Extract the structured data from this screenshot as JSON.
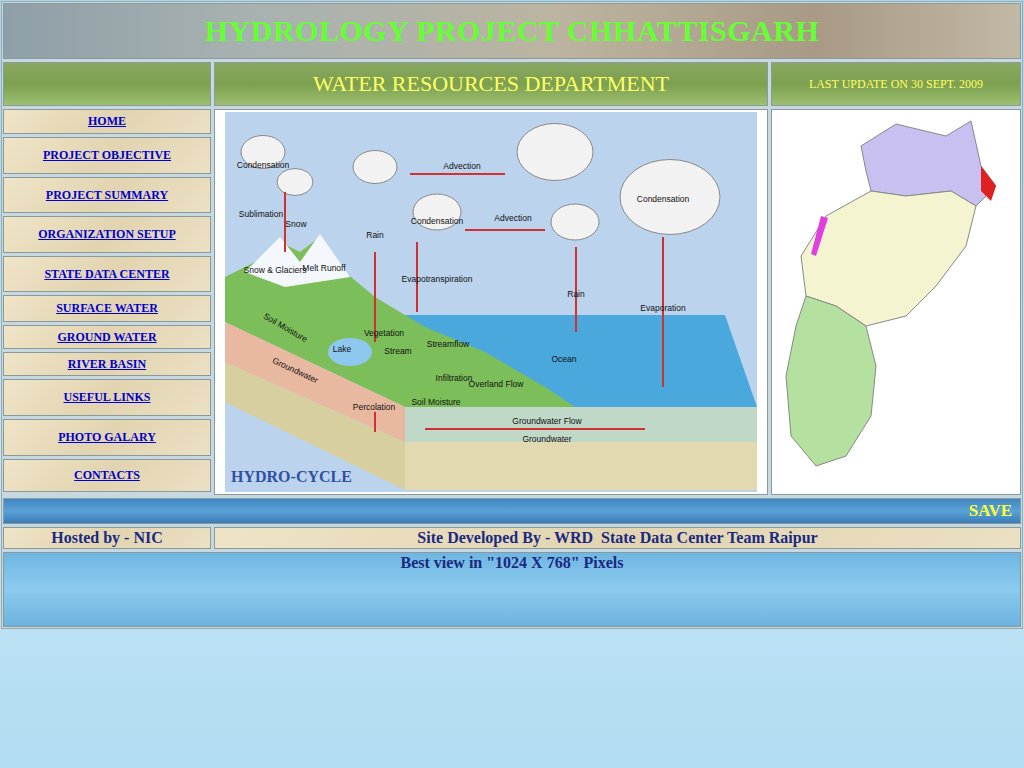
{
  "header": {
    "title": "HYDROLOGY PROJECT CHHATTISGARH"
  },
  "subheader": {
    "department": "WATER RESOURCES DEPARTMENT",
    "last_update": "LAST UPDATE ON 30 SEPT. 2009"
  },
  "nav": [
    {
      "label": "HOME"
    },
    {
      "label": "PROJECT OBJECTIVE"
    },
    {
      "label": "PROJECT SUMMARY"
    },
    {
      "label": "ORGANIZATION SETUP"
    },
    {
      "label": "STATE DATA CENTER"
    },
    {
      "label": "SURFACE WATER"
    },
    {
      "label": "GROUND WATER"
    },
    {
      "label": "RIVER BASIN"
    },
    {
      "label": "USEFUL LINKS"
    },
    {
      "label": "PHOTO GALARY"
    },
    {
      "label": "CONTACTS"
    }
  ],
  "diagram": {
    "title": "HYDRO-CYCLE",
    "labels": [
      "Condensation",
      "Sublimation",
      "Snow",
      "Rain",
      "Advection",
      "Condensation",
      "Advection",
      "Condensation",
      "Snow & Glaciers",
      "Melt Runoff",
      "Evapotranspiration",
      "Rain",
      "Evaporation",
      "Soil Moisture",
      "Vegetation",
      "Lake",
      "Stream",
      "Streamflow",
      "Ocean",
      "Groundwater",
      "Infiltration",
      "Overland Flow",
      "Soil Moisture",
      "Percolation",
      "Groundwater Flow",
      "Groundwater"
    ]
  },
  "save_bar": {
    "label": "SAVE"
  },
  "footer": {
    "hosted_by": "Hosted by - NIC",
    "developer": "Site Developed By - WRD  State Data Center Team Raipur",
    "best_view": "Best view in \"1024 X 768\" Pixels"
  }
}
